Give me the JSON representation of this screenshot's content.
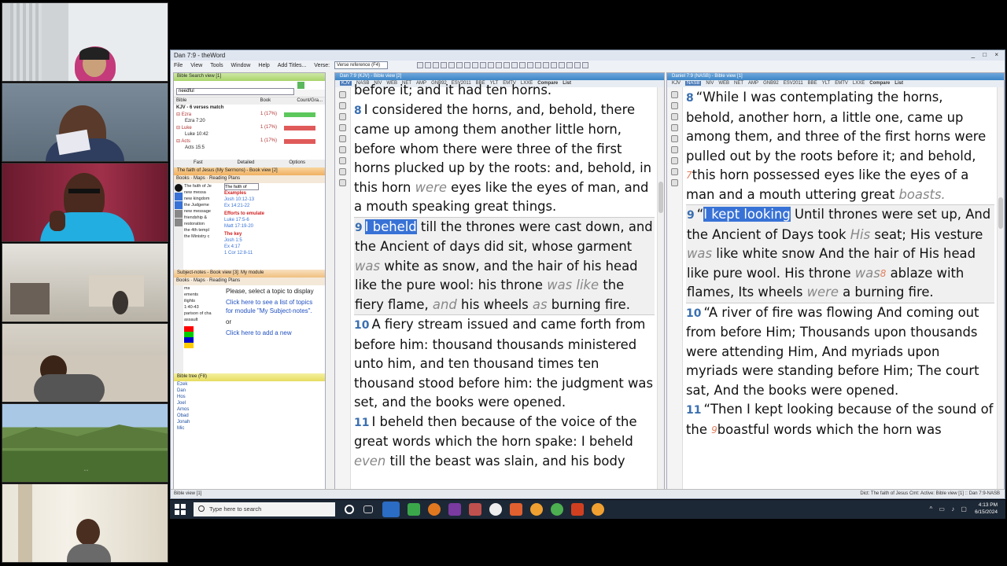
{
  "app": {
    "title": "Dan 7:9 - theWord",
    "window_controls": "_ □ ×",
    "menu": [
      "File",
      "View",
      "Tools",
      "Window",
      "Help",
      "Add Titles...",
      "Verse:"
    ],
    "verse_combo": "Verse reference (F4)"
  },
  "left_panels": {
    "search_title": "Bible Search view [1]",
    "search_input": "needful",
    "search_cols": [
      "Bible",
      "Book",
      "Count/Gra..."
    ],
    "search_result_head": "KJV - 6 verses match",
    "search_results": [
      {
        "book": "Ezra",
        "count": "1 (17%)",
        "ref": "Ezra 7:20"
      },
      {
        "book": "Luke",
        "count": "1 (17%)",
        "ref": "Luke 10:42"
      },
      {
        "book": "Acts",
        "count": "1 (17%)",
        "ref": "Acts 15:5"
      }
    ],
    "search_footer": [
      "Fast",
      "Detailed",
      "Options"
    ],
    "book_title": "The faith of Jesus (My Sermons) - Book view [2]",
    "book_tabs": [
      "Books",
      "Maps",
      "Reading Plans"
    ],
    "book_combo": "The faith of",
    "book_tree": [
      "The faith of Je",
      "new messa",
      "new kingdom",
      "the Judgeme",
      "new message",
      "friendship &",
      "restoration",
      "the 4th templ",
      "the Ministry c"
    ],
    "book_content": {
      "examples_head": "Examples",
      "ref1": "Josh 10:12-13",
      "ref2": "Ex 14:21-22",
      "emulate_head": "Efforts to emulate",
      "ref3": "Luke 17:5-6",
      "ref4": "Matt 17:19-20",
      "key_head": "The key",
      "ref5": "Josh 1:5",
      "ref6": "Ex 4:17",
      "ref7": "1 Cor 12:8-11"
    },
    "subject_title": "Subject-notes - Book view [3]: My module",
    "subject_tabs": [
      "Books",
      "Maps",
      "Reading Plans"
    ],
    "subject_tree": [
      "ms",
      "ements",
      "ilights",
      "1:40-43",
      "parison of cha",
      "assault"
    ],
    "subject_prompt": "Please, select a topic to display",
    "subject_link1": "Click here to see a list of topics for module \"My Subject-notes\".",
    "subject_or": "or",
    "subject_link2": "Click here to add a new",
    "tree_title": "Bible tree (F8)",
    "tree_books": [
      "Ezek",
      "Dan",
      "Hos",
      "Joel",
      "Amos",
      "Obad",
      "Jonah",
      "Mic"
    ]
  },
  "left_pane": {
    "header": "Dan 7:9 (KJV) - Bible view [2]",
    "versions": [
      "KJV",
      "NASB",
      "NIV",
      "WEB",
      "NET",
      "AMP",
      "GNB92",
      "ESV2011",
      "BBE",
      "YLT",
      "EMTV",
      "LXXE",
      "Compare",
      "List"
    ],
    "top_line": "before it; and it had ten horns.",
    "v8_num": "8",
    "v8_a": "I considered the horns, and, behold, there came up among them another little horn, before whom there were three of the first horns plucked up by the roots: and, behold, in this horn ",
    "v8_it": "were",
    "v8_b": " eyes like the eyes of man, and a mouth speaking great things.",
    "v9_num": "9",
    "v9_hl": "I beheld",
    "v9_a": " till the thrones were cast down, and the Ancient of days did sit, whose garment ",
    "v9_it1": "was",
    "v9_b": " white as snow, and the hair of his head like the pure wool: his throne ",
    "v9_it2": "was like",
    "v9_c": " the fiery flame, ",
    "v9_it3": "and",
    "v9_d": " his wheels ",
    "v9_it4": "as",
    "v9_e": " burning fire.",
    "v10_num": "10",
    "v10": "A fiery stream issued and came forth from before him: thousand thousands ministered unto him, and ten thousand times ten thousand stood before him: the judgment was set, and the books were opened.",
    "v11_num": "11",
    "v11_a": "I beheld then because of the voice of the great words which the horn spake: I beheld ",
    "v11_it": "even",
    "v11_b": " till the beast was slain, and his body"
  },
  "right_pane": {
    "header": "Daniel 7:9 (NASB) - Bible view [1]",
    "versions": [
      "KJV",
      "NASB",
      "NIV",
      "WEB",
      "NET",
      "AMP",
      "GNB92",
      "ESV2011",
      "BBE",
      "YLT",
      "EMTV",
      "LXXE",
      "Compare",
      "List"
    ],
    "v8_num": "8",
    "v8_a": "“While I was contemplating the horns, behold, another horn, a little one, came up among them, and three of the first horns were pulled out by the roots before it; and behold, ",
    "v8_fn": "7",
    "v8_b": "this horn possessed eyes like the eyes of a man and a mouth uttering great ",
    "v8_it": "boasts.",
    "v9_num": "9",
    "v9_q": "“",
    "v9_hl": "I kept looking",
    "v9_a": " Until thrones were set up, And the Ancient of Days took ",
    "v9_it1": "His",
    "v9_b": " seat; His vesture ",
    "v9_it2": "was",
    "v9_c": " like white snow And the hair of His head like pure wool. His throne ",
    "v9_it3": "was",
    "v9_fn": "8",
    "v9_d": " ablaze with flames, Its wheels ",
    "v9_it4": "were",
    "v9_e": " a burning fire.",
    "v10_num": "10",
    "v10": "“A river of fire was flowing And coming out from before Him; Thousands upon thousands were attending Him, And myriads upon myriads were standing before Him; The court sat, And the books were opened.",
    "v11_num": "11",
    "v11_a": "“Then I kept looking because of the sound of the ",
    "v11_fn": "9",
    "v11_b": "boastful words which the horn was"
  },
  "statusbar": {
    "left": "Bible view [1]",
    "right": "Dict: The faith of Jesus   Cmt:   Active: Bible view [1] :: Dan 7:9-NASB"
  },
  "taskbar": {
    "search_placeholder": "Type here to search",
    "time": "4:13 PM",
    "date": "6/15/2024"
  },
  "colors": {
    "accent": "#3872d6",
    "verse_num": "#3a6fb0",
    "italic": "#888888",
    "taskbar": "#1d2836"
  }
}
